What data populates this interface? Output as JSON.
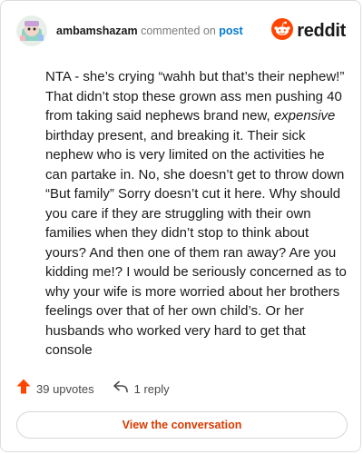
{
  "header": {
    "username": "ambamshazam",
    "action_text": " commented on ",
    "post_link": "post",
    "logo_text": "reddit"
  },
  "comment": {
    "text_before_emphasis": "NTA - she’s crying “wahh but that’s their nephew!” That didn’t stop these grown ass men pushing 40 from taking said nephews brand new, ",
    "emphasis": "expensive",
    "text_after_emphasis": " birthday present, and breaking it. Their sick nephew who is very limited on the activities he can partake in. No, she doesn’t get to throw down “But family” Sorry doesn’t cut it here. Why should you care if they are struggling with their own families when they didn’t stop to think about yours? And then one of them ran away? Are you kidding me!? I would be seriously concerned as to why your wife is more worried about her brothers feelings over that of her own child’s. Or her husbands who worked very hard to get that console"
  },
  "actions": {
    "upvotes": "39 upvotes",
    "replies": "1 reply"
  },
  "footer": {
    "view_button": "View the conversation"
  },
  "colors": {
    "reddit_orange": "#ff4500",
    "link_blue": "#0079d3",
    "button_text": "#d93a00"
  },
  "icons": {
    "avatar": "snoo-avatar-icon",
    "logo": "reddit-snoo-icon",
    "upvote": "upvote-arrow-icon",
    "reply": "reply-arrow-icon"
  }
}
